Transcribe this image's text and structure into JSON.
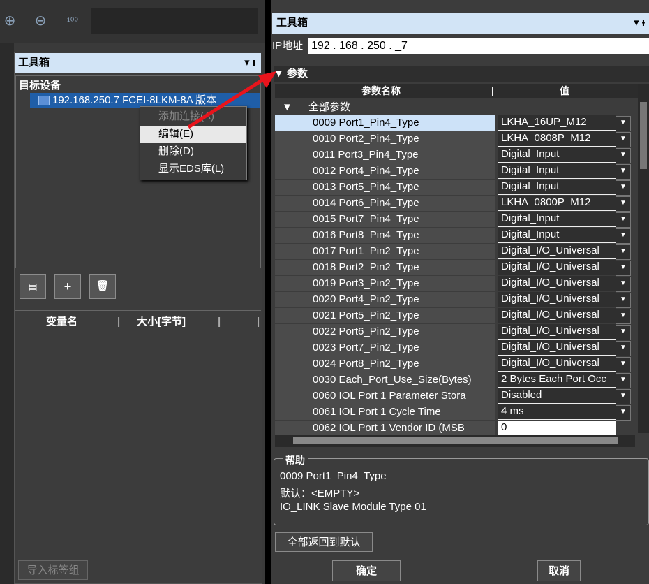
{
  "left": {
    "zoom_icons": [
      "zoom-in-icon",
      "zoom-out-icon",
      "zoom-100-icon"
    ],
    "toolbox_title": "工具箱",
    "pin_glyph": "▾ ᵻ",
    "tree_title": "目标设备",
    "device_row": "192.168.250.7   FCEI-8LKM-8A   版本",
    "context_menu": [
      "添加连接(A)",
      "编辑(E)",
      "删除(D)",
      "显示EDS库(L)"
    ],
    "var_headers": [
      "变量名",
      "大小[字节]"
    ],
    "import_label": "导入标签组"
  },
  "right": {
    "title": "工具箱",
    "pin_glyph": "▾ ᵻ",
    "ip_label": "IP地址",
    "ip_value": "192 . 168 . 250 . _7",
    "params_section": "▼ 参数",
    "col_name": "参数名称",
    "col_value": "值",
    "all_params": "全部参数",
    "params": [
      {
        "name": "0009 Port1_Pin4_Type",
        "value": "LKHA_16UP_M12",
        "selected": true
      },
      {
        "name": "0010 Port2_Pin4_Type",
        "value": "LKHA_0808P_M12"
      },
      {
        "name": "0011 Port3_Pin4_Type",
        "value": "Digital_Input"
      },
      {
        "name": "0012 Port4_Pin4_Type",
        "value": "Digital_Input"
      },
      {
        "name": "0013 Port5_Pin4_Type",
        "value": "Digital_Input"
      },
      {
        "name": "0014 Port6_Pin4_Type",
        "value": "LKHA_0800P_M12"
      },
      {
        "name": "0015 Port7_Pin4_Type",
        "value": "Digital_Input"
      },
      {
        "name": "0016 Port8_Pin4_Type",
        "value": "Digital_Input"
      },
      {
        "name": "0017 Port1_Pin2_Type",
        "value": "Digital_I/O_Universal"
      },
      {
        "name": "0018 Port2_Pin2_Type",
        "value": "Digital_I/O_Universal"
      },
      {
        "name": "0019 Port3_Pin2_Type",
        "value": "Digital_I/O_Universal"
      },
      {
        "name": "0020 Port4_Pin2_Type",
        "value": "Digital_I/O_Universal"
      },
      {
        "name": "0021 Port5_Pin2_Type",
        "value": "Digital_I/O_Universal"
      },
      {
        "name": "0022 Port6_Pin2_Type",
        "value": "Digital_I/O_Universal"
      },
      {
        "name": "0023 Port7_Pin2_Type",
        "value": "Digital_I/O_Universal"
      },
      {
        "name": "0024 Port8_Pin2_Type",
        "value": "Digital_I/O_Universal"
      },
      {
        "name": "0030 Each_Port_Use_Size(Bytes)",
        "value": "2 Bytes Each Port Occ"
      },
      {
        "name": "0060 IOL Port 1 Parameter Stora",
        "value": "Disabled"
      },
      {
        "name": "0061 IOL Port 1 Cycle Time",
        "value": "4 ms"
      },
      {
        "name": "0062 IOL Port 1 Vendor ID (MSB",
        "value": "0",
        "plain": true
      }
    ],
    "help_title": "帮助",
    "help_lines": [
      "0009 Port1_Pin4_Type",
      "默认：<EMPTY>",
      "IO_LINK Slave Module Type 01"
    ],
    "reset_label": "全部返回到默认",
    "ok_label": "确定",
    "cancel_label": "取消"
  },
  "colors": {
    "selection_blue": "#1f5ea8",
    "header_blue": "#d2e4f6",
    "arrow_red": "#e8141c"
  }
}
